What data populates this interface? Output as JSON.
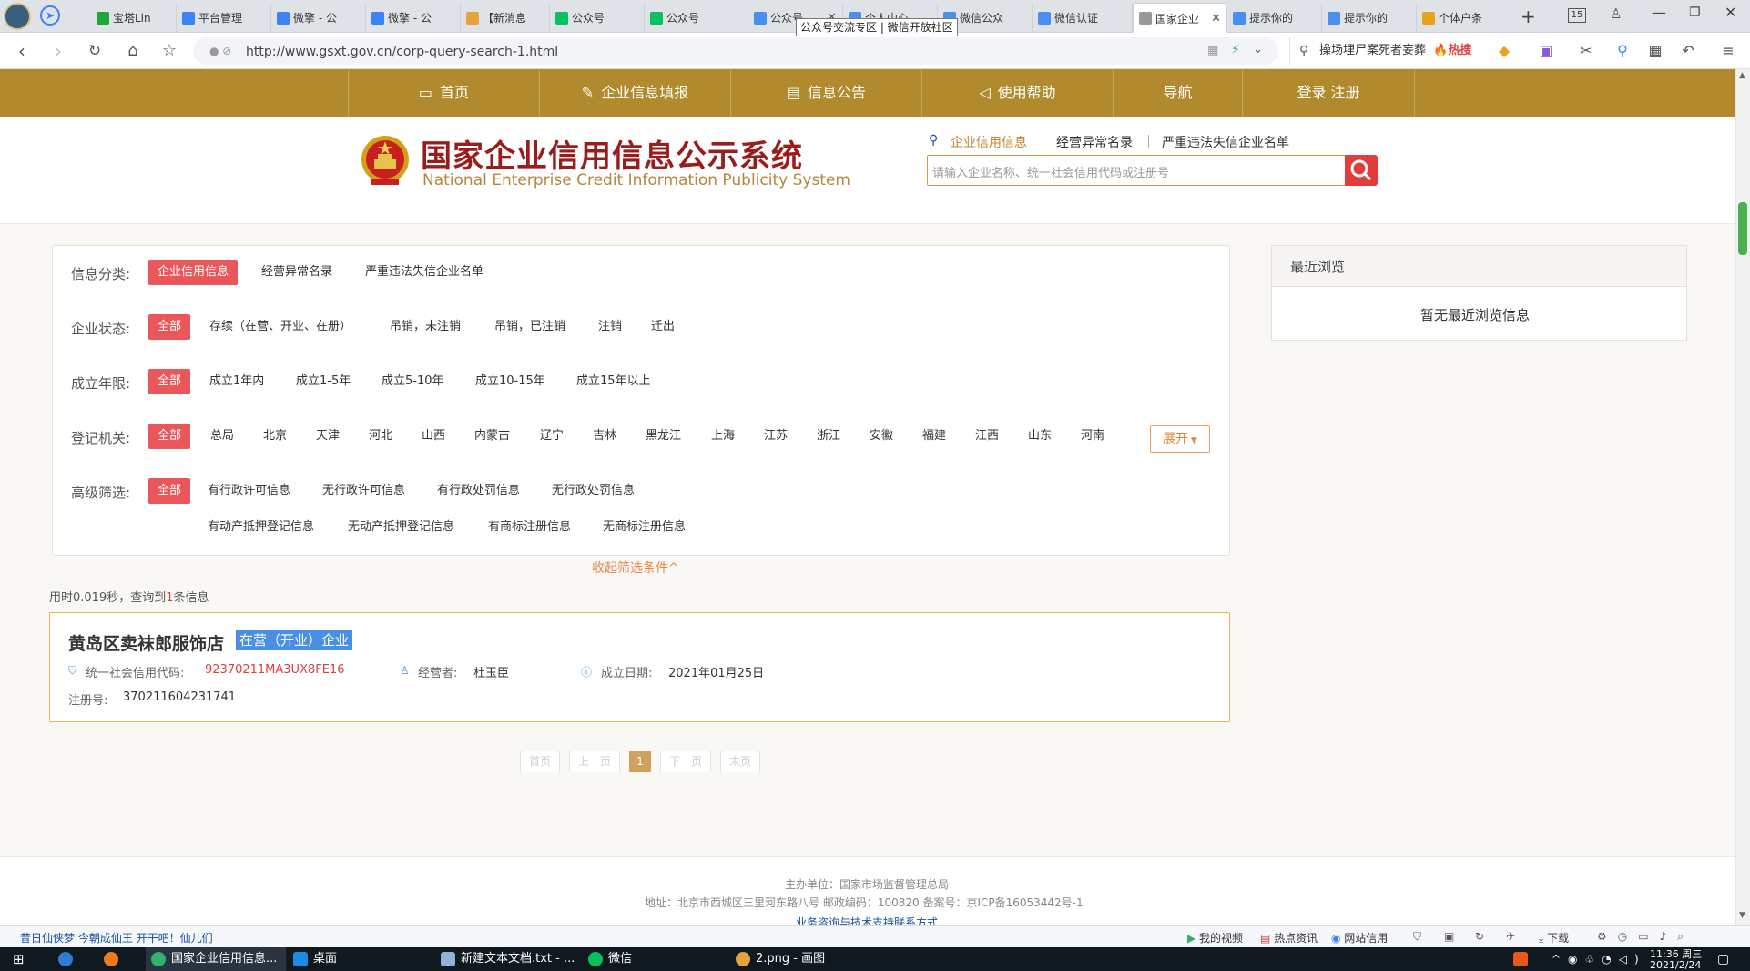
{
  "browser": {
    "tabs": [
      {
        "label": "宝塔Lin",
        "icon": "bt-icon",
        "color": "#20a53a"
      },
      {
        "label": "平台管理",
        "icon": "globe-icon",
        "color": "#3b82f6"
      },
      {
        "label": "微擎 - 公",
        "icon": "globe-icon",
        "color": "#3b82f6"
      },
      {
        "label": "微擎 - 公",
        "icon": "globe-icon",
        "color": "#3b82f6"
      },
      {
        "label": "【新消息",
        "icon": "doc-icon",
        "color": "#e6a23c"
      },
      {
        "label": "公众号",
        "icon": "wechat-icon",
        "color": "#07c160"
      },
      {
        "label": "公众号",
        "icon": "wechat-icon",
        "color": "#07c160"
      },
      {
        "label": "公众号",
        "icon": "grid-icon",
        "color": "#4b8ef0"
      },
      {
        "label": "个人中心",
        "icon": "grid-icon",
        "color": "#4b8ef0"
      },
      {
        "label": "微信公众",
        "icon": "grid-icon",
        "color": "#4b8ef0"
      },
      {
        "label": "微信认证",
        "icon": "grid-icon",
        "color": "#4b8ef0"
      },
      {
        "label": "国家企业",
        "icon": "page-icon",
        "color": "#999999"
      },
      {
        "label": "提示你的",
        "icon": "grid-icon",
        "color": "#4b8ef0"
      },
      {
        "label": "提示你的",
        "icon": "grid-icon",
        "color": "#4b8ef0"
      },
      {
        "label": "个体户条",
        "icon": "search-icon",
        "color": "#e8a21b"
      }
    ],
    "tab_count": "15",
    "tooltip": "公众号交流专区 | 微信开放社区",
    "url": "http://www.gsxt.gov.cn/corp-query-search-1.html",
    "hot_search": "操场埋尸案死者妄葬",
    "hot_badge": "热搜"
  },
  "site": {
    "nav": [
      "首页",
      "企业信息填报",
      "信息公告",
      "使用帮助",
      "导航",
      "登录  注册"
    ],
    "title_cn": "国家企业信用信息公示系统",
    "title_en": "National Enterprise Credit Information Publicity System",
    "search_tabs": [
      "企业信用信息",
      "经营异常名录",
      "严重违法失信企业名单"
    ],
    "search_placeholder": "请输入企业名称、统一社会信用代码或注册号"
  },
  "filters": {
    "category_label": "信息分类:",
    "category_options": [
      "企业信用信息",
      "经营异常名录",
      "严重违法失信企业名单"
    ],
    "status_label": "企业状态:",
    "status_options": [
      "全部",
      "存续（在营、开业、在册）",
      "吊销，未注销",
      "吊销，已注销",
      "注销",
      "迁出"
    ],
    "years_label": "成立年限:",
    "years_options": [
      "全部",
      "成立1年内",
      "成立1-5年",
      "成立5-10年",
      "成立10-15年",
      "成立15年以上"
    ],
    "region_label": "登记机关:",
    "region_options": [
      "全部",
      "总局",
      "北京",
      "天津",
      "河北",
      "山西",
      "内蒙古",
      "辽宁",
      "吉林",
      "黑龙江",
      "上海",
      "江苏",
      "浙江",
      "安徽",
      "福建",
      "江西",
      "山东",
      "河南"
    ],
    "expand_label": "展开",
    "advanced_label": "高级筛选:",
    "advanced_options_row1": [
      "全部",
      "有行政许可信息",
      "无行政许可信息",
      "有行政处罚信息",
      "无行政处罚信息"
    ],
    "advanced_options_row2": [
      "有动产抵押登记信息",
      "无动产抵押登记信息",
      "有商标注册信息",
      "无商标注册信息"
    ],
    "collapse_label": "收起筛选条件^"
  },
  "results": {
    "query_prefix": "用时0.019秒，查询到",
    "query_count": "1",
    "query_suffix": "条信息",
    "company": {
      "name": "黄岛区卖袜郎服饰店",
      "status": "在营（开业）企业",
      "credit_code_label": "统一社会信用代码:",
      "credit_code": "92370211MA3UX8FE16",
      "operator_label": "经营者:",
      "operator": "杜玉臣",
      "founded_label": "成立日期:",
      "founded": "2021年01月25日",
      "reg_label": "注册号:",
      "reg_no": "370211604231741"
    }
  },
  "pagination": [
    "首页",
    "上一页",
    "1",
    "下一页",
    "末页"
  ],
  "recent": {
    "title": "最近浏览",
    "empty": "暂无最近浏览信息"
  },
  "footer": {
    "line1": "主办单位：国家市场监督管理总局",
    "line2": "地址：北京市西城区三里河东路八号    邮政编码：100820    备案号：京ICP备16053442号-1",
    "line3": "业务咨询与技术支持联系方式"
  },
  "statusbar": {
    "news": "昔日仙侠梦  今朝成仙王  开干吧！仙儿们",
    "items": [
      "我的视频",
      "热点资讯",
      "网站信用"
    ],
    "download": "下载"
  },
  "taskbar": {
    "apps": [
      "国家企业信用信息...",
      "桌面",
      "新建文本文档.txt - ...",
      "微信",
      "2.png - 画图"
    ],
    "time": "11:36 周三",
    "date": "2021/2/24"
  },
  "colors": {
    "nav_bg": "#b08a2c",
    "selected_red": "#e9575a",
    "status_blue": "#4a90e2",
    "credit_code_red": "#e23c3c"
  }
}
